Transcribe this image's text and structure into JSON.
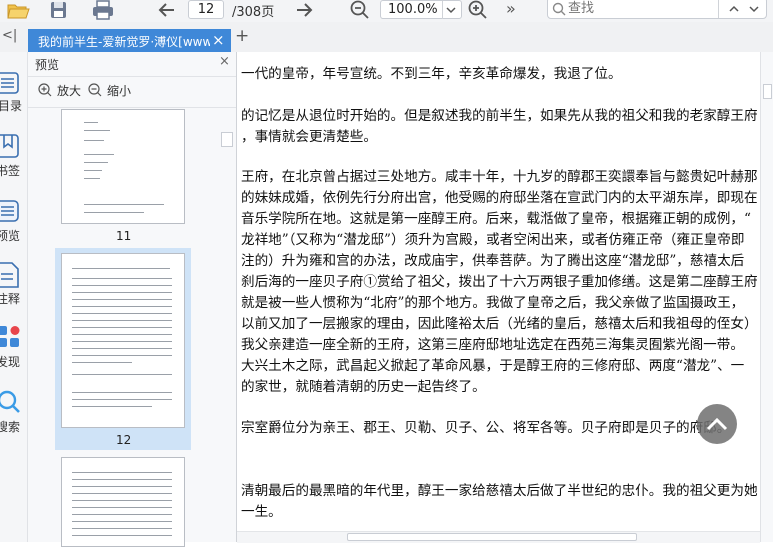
{
  "toolbar": {
    "current_page": "12",
    "total_pages": "/308页",
    "zoom": "100.0%",
    "more": "»",
    "search_placeholder": "查找",
    "icons": [
      "open-folder-icon",
      "save-icon",
      "print-icon",
      "prev-page-icon",
      "next-page-icon",
      "zoom-out-icon",
      "zoom-in-icon",
      "more-icon",
      "search-icon",
      "search-prev-icon",
      "search-next-icon"
    ]
  },
  "tabs": {
    "collapse": "<|",
    "doc_title": "我的前半生-爱新觉罗·溥仪[www",
    "close": "×",
    "add": "+"
  },
  "rail": {
    "toc": "目录",
    "bookmarks": "书签",
    "preview": "预览",
    "notes": "注释",
    "discover": "发现",
    "search": "搜索"
  },
  "preview": {
    "title": "预览",
    "close": "×",
    "zoom_in": "放大",
    "zoom_out": "缩小",
    "thumbs": [
      {
        "num": "11"
      },
      {
        "num": "12",
        "selected": true
      },
      {
        "num": ""
      }
    ]
  },
  "document": {
    "lines": [
      "一代的皇帝，年号宣统。不到三年，辛亥革命爆发，我退了位。",
      "",
      "的记忆是从退位时开始的。但是叙述我的前半生，如果先从我的祖父和我的老家醇王府",
      "，事情就会更清楚些。",
      "",
      "王府，在北京曾占据过三处地方。咸丰十年，十九岁的醇郡王奕譞奉旨与懿贵妃叶赫那",
      "的妹妹成婚，依例先行分府出宫，他受赐的府邸坐落在宣武门内的太平湖东岸，即现在",
      "音乐学院所在地。这就是第一座醇王府。后来，载湉做了皇帝，根据雍正朝的成例，“",
      "龙祥地”（又称为“潜龙邸”）须升为宫殿，或者空闲出来，或者仿雍正帝（雍正皇帝即",
      "注的）升为雍和宫的办法，改成庙宇，供奉菩萨。为了腾出这座“潜龙邸”，慈禧太后",
      "刹后海的一座贝子府①赏给了祖父，拨出了十六万两银子重加修缮。这是第二座醇王府",
      "就是被一些人惯称为“北府”的那个地方。我做了皇帝之后，我父亲做了监国摄政王，",
      "以前又加了一层搬家的理由，因此隆裕太后（光绪的皇后，慈禧太后和我祖母的侄女）",
      "我父亲建造一座全新的王府，这第三座府邸地址选定在西苑三海集灵囿紫光阁一带。",
      "大兴土木之际，武昌起义掀起了革命风暴，于是醇王府的三修府邸、两度“潜龙”、一",
      "的家世，就随着清朝的历史一起告终了。",
      "",
      "宗室爵位分为亲王、郡王、贝勒、贝子、公、将军各等。贝子府即是贝子的府邸。",
      "",
      "",
      "清朝最后的最黑暗的年代里，醇王一家给慈禧太后做了半世纪的忠仆。我的祖父更为她",
      "一生。"
    ]
  },
  "colors": {
    "tab_active": "#3f88d8",
    "thumb_selected": "#cfe3f7",
    "toolbar_bg": "#f3f4f6"
  }
}
